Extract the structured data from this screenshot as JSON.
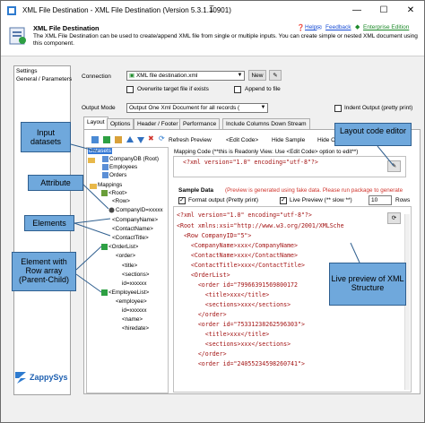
{
  "window": {
    "title": "XML File Destination - XML File Destination (Version 5.3.1.10901)",
    "minimize": "—",
    "maximize": "☐",
    "close": "✕"
  },
  "header": {
    "title": "XML File Destination",
    "description": "The XML File Destination can be used to create/append XML file from single or multiple inputs. You can create simple or nested XML document using this component.",
    "help": "Help",
    "feedback": "Feedback",
    "enterprise": "Enterprise Edition"
  },
  "sidebar": {
    "items": [
      "Settings",
      "General / Parameters"
    ]
  },
  "connection": {
    "label": "Connection",
    "value": "XML file destination.xml",
    "new_button": "New",
    "overwrite_label": "Overwrite target file if exists",
    "append_label": "Append to file"
  },
  "output_mode": {
    "label": "Output Mode",
    "value": "Output One Xml Document for all records (",
    "indent_label": "Indent Output (pretty print)"
  },
  "tabs": [
    "Layout",
    "Options",
    "Header / Footer",
    "Performance",
    "Include Columns Down Stream"
  ],
  "toolbar": {
    "refresh": "Refresh Preview",
    "edit_code": "<Edit Code>",
    "hide_sample": "Hide Sample",
    "hide_code": "Hide C"
  },
  "tree": {
    "datasets": "Datasets",
    "items": [
      "CompanyDB (Root)",
      "Employees",
      "Orders"
    ],
    "mappings": "Mappings",
    "nodes": [
      "<Root>",
      "<Row>",
      "CompanyID=xxxxx",
      "<CompanyName>",
      "<ContactName>",
      "<ContactTitle>",
      "<OrderList>",
      "<order>",
      "<title>",
      "<sections>",
      "id=xxxxxx",
      "<EmployeeList>",
      "<employee>",
      "id=xxxxxx",
      "<name>",
      "<hiredate>"
    ]
  },
  "mapping_code": {
    "label": "Mapping Code (**this is Readonly View. Use <Edit Code> option to edit**)",
    "line": "<?xml version=\"1.0\" encoding=\"utf-8\"?>"
  },
  "sample": {
    "title": "Sample Data",
    "notice": "(Preview is generated using fake data. Please run package to generate",
    "format_label": "Format output (Pretty print)",
    "live_label": "Live Preview (** slow **)",
    "rows_value": "10",
    "rows_label": "Rows",
    "lines": [
      "<?xml version=\"1.0\" encoding=\"utf-8\"?>",
      "<Root xmlns:xsi=\"http://www.w3.org/2001/XMLSche",
      "  <Row CompanyID=\"5\">",
      "    <CompanyName>xxx</CompanyName>",
      "    <ContactName>xxx</ContactName>",
      "    <ContactTitle>xxx</ContactTitle>",
      "    <OrderList>",
      "      <order id=\"79966391569800172",
      "        <title>xxx</title>",
      "        <sections>xxx</sections>",
      "      </order>",
      "      <order id=\"75331238262596303\">",
      "        <title>xxx</title>",
      "        <sections>xxx</sections>",
      "      </order>",
      "      <order id=\"24055234598260741\">"
    ]
  },
  "callouts": {
    "input": "Input datasets",
    "attribute": "Attribute",
    "elements": "Elements",
    "row_array": "Element with Row array (Parent-Child)",
    "layout_editor": "Layout code editor",
    "live_preview": "Live preview of XML Structure"
  },
  "footer": {
    "brand": "ZappySys"
  }
}
